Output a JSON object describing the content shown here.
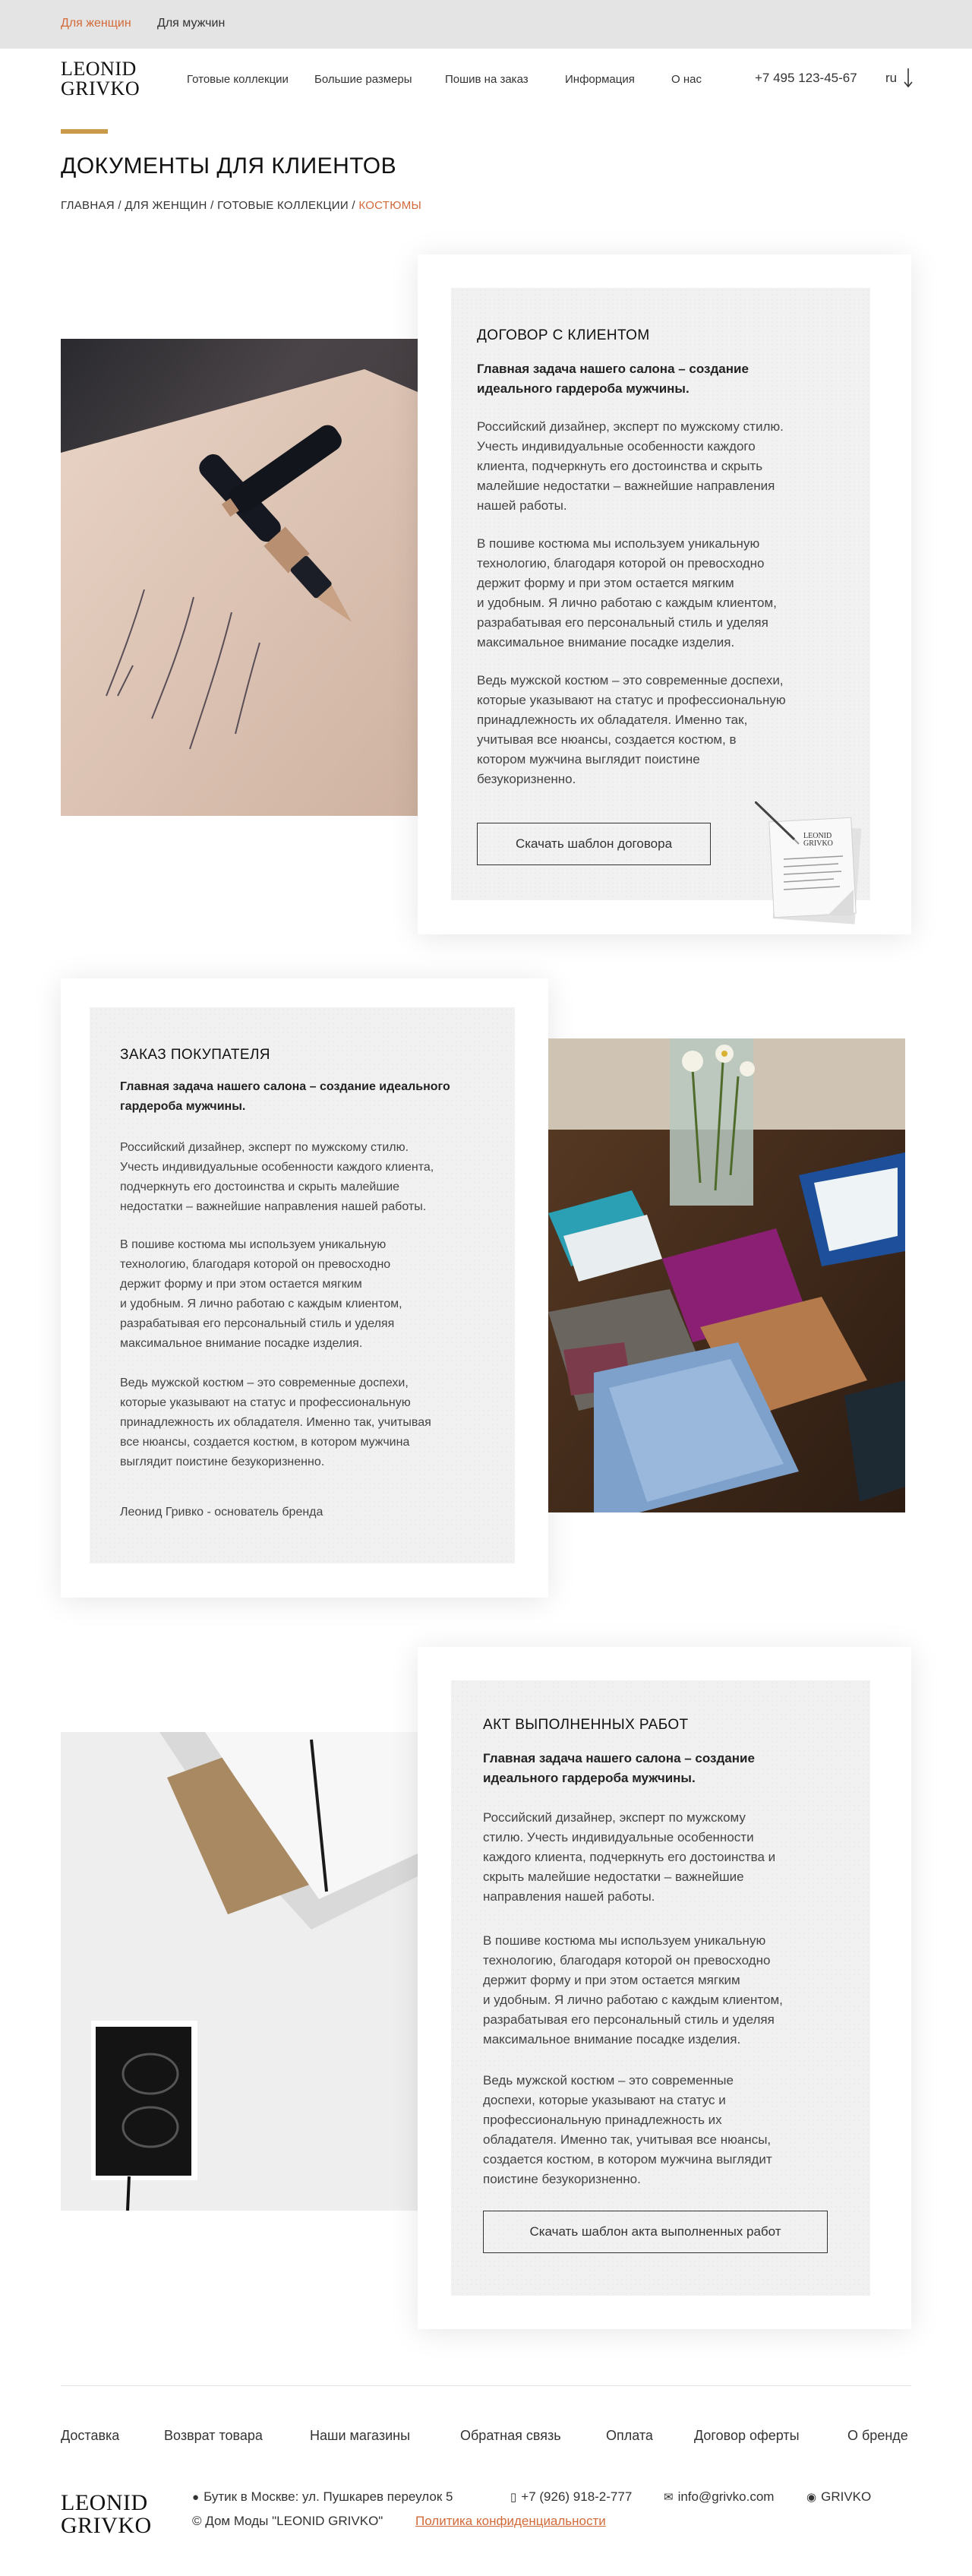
{
  "topbar": {
    "women": "Для женщин",
    "men": "Для мужчин"
  },
  "logo": {
    "line1": "LEONID",
    "line2": "GRIVKO"
  },
  "nav": [
    "Готовые коллекции",
    "Большие размеры",
    "Пошив на заказ",
    "Информация",
    "О нас"
  ],
  "header": {
    "phone": "+7 495 123-45-67",
    "lang": "ru"
  },
  "page": {
    "title": "ДОКУМЕНТЫ ДЛЯ КЛИЕНТОВ"
  },
  "breadcrumb": {
    "home": "ГЛАВНАЯ",
    "sep": "/",
    "women": "ДЛЯ ЖЕНЩИН",
    "collections": "ГОТОВЫЕ КОЛЛЕКЦИИ",
    "current": "КОСТЮМЫ"
  },
  "sections": [
    {
      "title": "ДОГОВОР С КЛИЕНТОМ",
      "lead": [
        "Главная задача нашего салона – создание",
        "идеального гардероба мужчины."
      ],
      "para1": [
        "Российский дизайнер, эксперт по мужскому стилю.",
        "Учесть индивидуальные особенности каждого",
        "клиента, подчеркнуть его достоинства и скрыть",
        "малейшие недостатки – важнейшие направления",
        "нашей работы."
      ],
      "para2": [
        "В пошиве костюма мы используем уникальную",
        "технологию, благодаря которой он превосходно",
        "держит форму и при этом остается мягким",
        "и удобным. Я лично работаю с каждым клиентом,",
        "разрабатывая его персональный стиль и уделяя",
        "максимальное внимание посадке изделия."
      ],
      "para3": [
        "Ведь мужской костюм – это современные доспехи,",
        "которые указывают на статус и профессиональную",
        "принадлежность их обладателя. Именно так,",
        "учитывая все нюансы, создается костюм, в",
        "котором мужчина выглядит поистине",
        "безукоризненно."
      ],
      "button": "Скачать шаблон договора",
      "doc_logo": [
        "LEONID",
        "GRIVKO"
      ]
    },
    {
      "title": "ЗАКАЗ ПОКУПАТЕЛЯ",
      "lead": [
        "Главная задача нашего салона – создание идеального",
        "гардероба мужчины."
      ],
      "para1": [
        "Российский дизайнер, эксперт по мужскому стилю.",
        "Учесть индивидуальные особенности каждого клиента,",
        "подчеркнуть его достоинства и скрыть малейшие",
        "недостатки – важнейшие направления нашей работы."
      ],
      "para2": [
        "В пошиве костюма мы используем уникальную",
        "технологию, благодаря которой он превосходно",
        "держит форму и при этом остается мягким",
        "и удобным. Я лично работаю с каждым клиентом,",
        "разрабатывая его персональный стиль и уделяя",
        "максимальное внимание посадке изделия."
      ],
      "para3": [
        "Ведь мужской костюм – это современные доспехи,",
        "которые указывают на статус и профессиональную",
        "принадлежность их обладателя. Именно так, учитывая",
        "все нюансы, создается костюм, в котором мужчина",
        "выглядит поистине безукоризненно."
      ],
      "signature": "Леонид Гривко - основатель бренда"
    },
    {
      "title": "АКТ ВЫПОЛНЕННЫХ РАБОТ",
      "lead": [
        "Главная задача нашего салона – создание",
        "идеального гардероба мужчины."
      ],
      "para1": [
        "Российский дизайнер, эксперт по мужскому",
        "стилю. Учесть индивидуальные особенности",
        "каждого клиента, подчеркнуть его достоинства и",
        "скрыть малейшие недостатки – важнейшие",
        "направления нашей работы."
      ],
      "para2": [
        "В пошиве костюма мы используем уникальную",
        "технологию, благодаря которой он превосходно",
        "держит форму и при этом остается мягким",
        "и удобным. Я лично работаю с каждым клиентом,",
        "разрабатывая его персональный стиль и уделяя",
        "максимальное внимание посадке изделия."
      ],
      "para3": [
        "Ведь мужской костюм – это современные",
        "доспехи, которые указывают на статус и",
        "профессиональную принадлежность их",
        "обладателя. Именно так, учитывая все нюансы,",
        "создается костюм, в котором мужчина выглядит",
        "поистине безукоризненно."
      ],
      "button": "Скачать шаблон акта выполненных работ"
    }
  ],
  "footer": {
    "links": [
      "Доставка",
      "Возврат товара",
      "Наши магазины",
      "Обратная связь",
      "Оплата",
      "Договор оферты",
      "О бренде"
    ],
    "address": "Бутик в Москве: ул. Пушкарев переулок 5",
    "phone": "+7 (926) 918-2-777",
    "email": "info@grivko.com",
    "brand": "GRIVKO",
    "copyright": "© Дом Моды \"LEONID GRIVKO\"",
    "policy": "Политика конфиденциальности"
  },
  "colors": {
    "accent": "#d36a3a",
    "gold": "#c89a4a",
    "topbar": "#e4e4e4",
    "paper": "#f1f1f1"
  },
  "icons": [
    "arrow-down-icon",
    "location-pin-icon",
    "mobile-phone-icon",
    "mail-icon",
    "brand-circle-icon"
  ]
}
